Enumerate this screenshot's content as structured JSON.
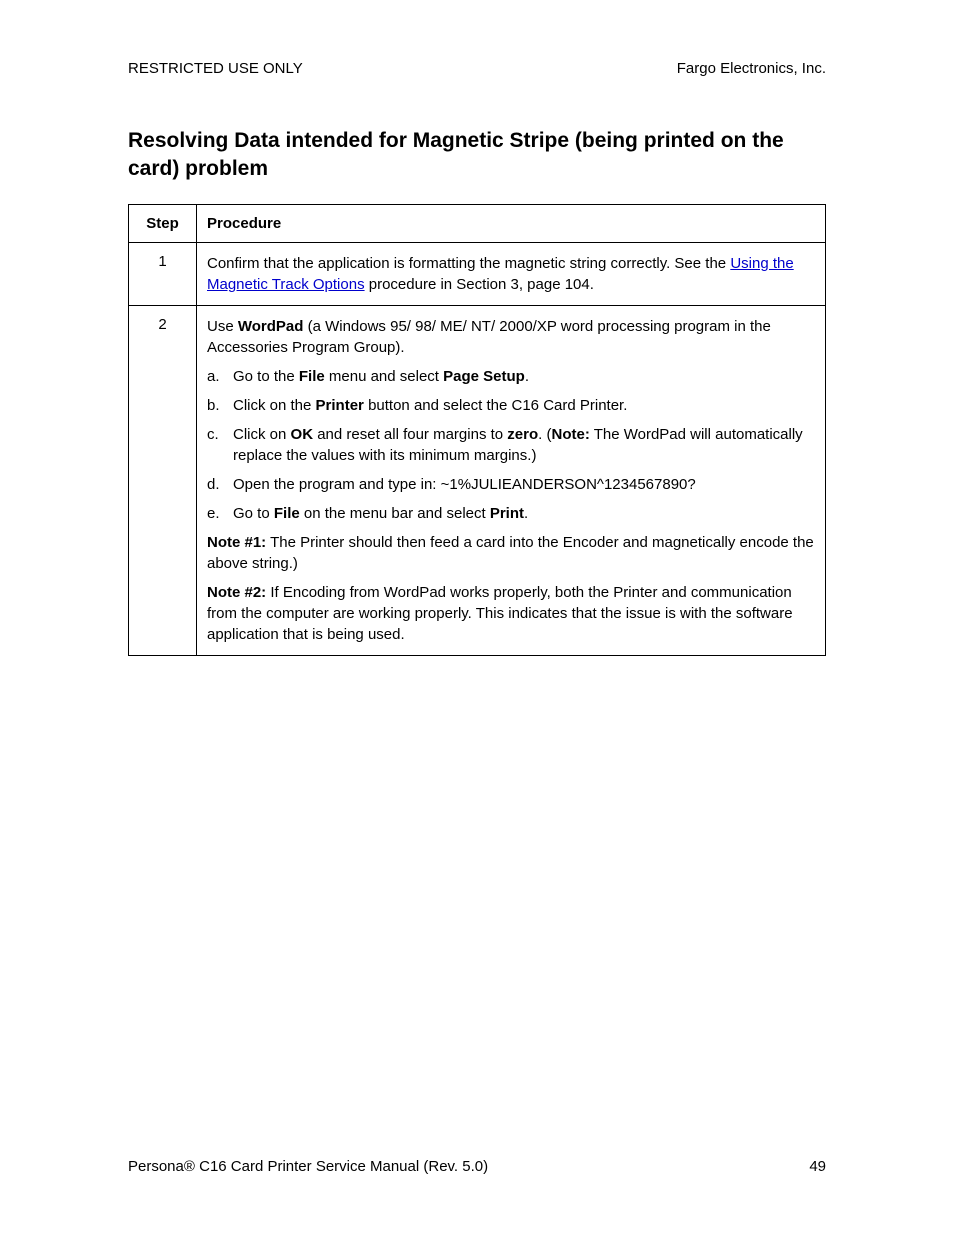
{
  "header": {
    "left": "RESTRICTED USE ONLY",
    "right": "Fargo Electronics, Inc."
  },
  "title": "Resolving Data intended for Magnetic Stripe (being printed on the card) problem",
  "table": {
    "colHeaders": {
      "step": "Step",
      "procedure": "Procedure"
    },
    "rows": {
      "r1": {
        "step": "1",
        "textBefore": "Confirm that the application is formatting the magnetic string correctly. See the ",
        "linkText": "Using the Magnetic Track Options",
        "textAfter": " procedure in Section 3, page 104."
      },
      "r2": {
        "step": "2",
        "intro": {
          "before": "Use ",
          "bold1": "WordPad",
          "after": " (a Windows 95/ 98/ ME/ NT/ 2000/XP word processing program in the Accessories Program Group)."
        },
        "items": {
          "a": {
            "marker": "a.",
            "b1": "File",
            "t1": "Go to the ",
            "t2": " menu and select ",
            "b2": "Page Setup",
            "t3": "."
          },
          "b": {
            "marker": "b.",
            "t1": "Click on the ",
            "b1": "Printer",
            "t2": " button and select the C16 Card Printer."
          },
          "c": {
            "marker": "c.",
            "t1": "Click on ",
            "b1": "OK",
            "t2": " and reset all four margins to ",
            "b2": "zero",
            "t3": ". (",
            "b3": "Note:",
            "t4": "  The WordPad will automatically replace the values with its minimum margins.)"
          },
          "d": {
            "marker": "d.",
            "t1": "Open the program and type in: ~1%JULIEANDERSON^1234567890?"
          },
          "e": {
            "marker": "e.",
            "t1": "Go to ",
            "b1": "File",
            "t2": " on the menu bar and select ",
            "b2": "Print",
            "t3": "."
          }
        },
        "note1": {
          "label": "Note #1:",
          "text": " The Printer should then feed a card into the Encoder and magnetically encode the above string.)"
        },
        "note2": {
          "label": "Note #2:",
          "text": "  If Encoding from WordPad works properly, both the Printer and communication from the computer are working properly. This indicates that the issue is with the software application that is being used."
        }
      }
    }
  },
  "footer": {
    "leftBefore": "Persona",
    "reg": "®",
    "leftAfter": " C16 Card Printer Service Manual (Rev. 5.0)",
    "pageNum": "49"
  }
}
